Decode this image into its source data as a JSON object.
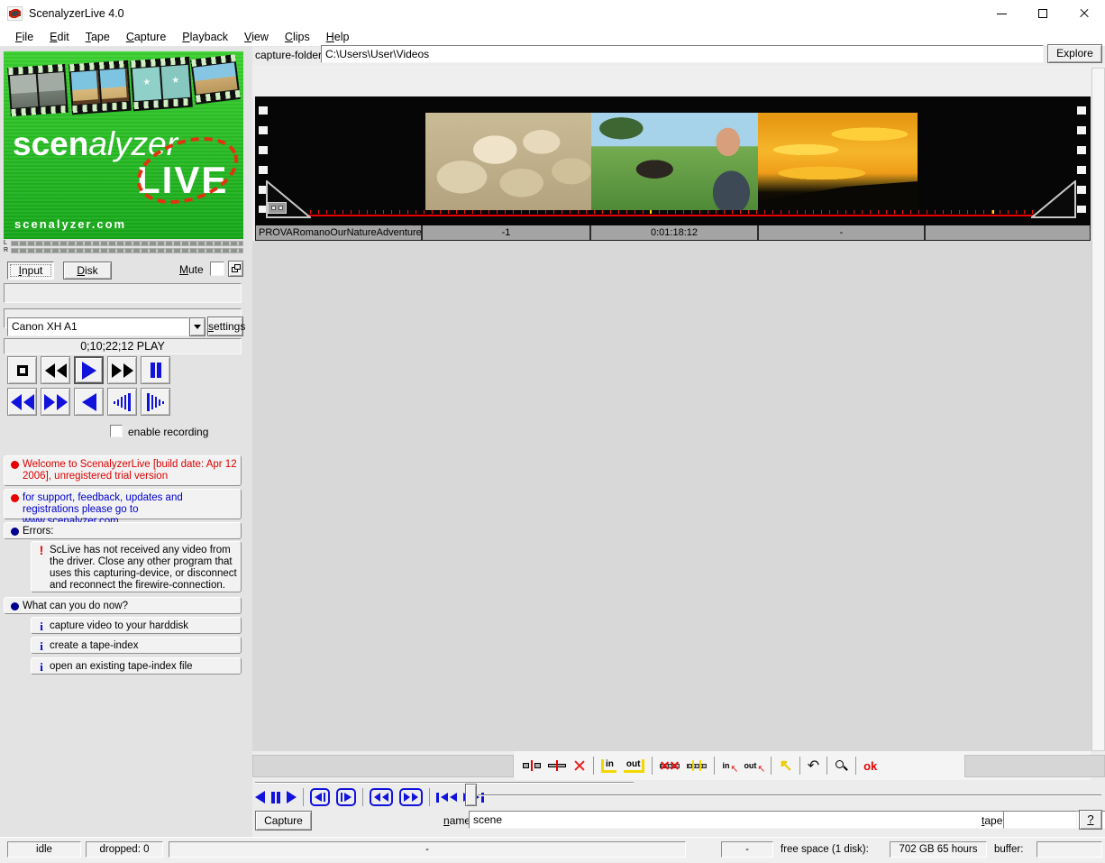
{
  "window": {
    "title": "ScenalyzerLive 4.0"
  },
  "menu": {
    "items": [
      "File",
      "Edit",
      "Tape",
      "Capture",
      "Playback",
      "View",
      "Clips",
      "Help"
    ]
  },
  "capture_folder": {
    "label": "capture-folder:",
    "path": "C:\\Users\\User\\Videos",
    "explore_button": "Explore"
  },
  "logo": {
    "brand_bold": "scen",
    "brand_italic": "alyzer",
    "live": "LIVE",
    "site": "scenalyzer.com"
  },
  "sidebar": {
    "meter_left": "L",
    "meter_right": "R",
    "input_button": "Input",
    "disk_button": "Disk",
    "mute_label": "Mute",
    "device_selected": "Canon XH A1",
    "settings_button": "settings",
    "timecode": "0;10;22;12 PLAY",
    "enable_recording_label": "enable recording",
    "messages": [
      {
        "text": "Welcome to ScenalyzerLive [build date: Apr 12 2006], unregistered trial version"
      },
      {
        "text": "for support, feedback, updates and registrations please go to www.scenalyzer.com"
      },
      {
        "text": "Errors:"
      },
      {
        "text": "ScLive has not received any video from the driver. Close any other program that uses this capturing-device, or disconnect and reconnect the firewire-connection."
      },
      {
        "text": "What can you do now?"
      },
      {
        "text": "capture video to your harddisk"
      },
      {
        "text": "create a tape-index"
      },
      {
        "text": "open an existing tape-index file"
      }
    ]
  },
  "filmstrip": {
    "labels": [
      "PROVARomanoOurNatureAdventure",
      "-1",
      "0:01:18:12",
      "-",
      ""
    ],
    "thumbnails": [
      "sheep-flock",
      "boy-with-horse",
      "sunset"
    ]
  },
  "toolbar": {
    "in_label": "in",
    "out_label": "out",
    "goto_in_label": "in",
    "goto_out_label": "out",
    "ok_label": "ok"
  },
  "capture_row": {
    "capture_button": "Capture",
    "name_label": "name:",
    "name_value": "scene",
    "tape_label": "tape:",
    "tape_value": "",
    "help_button": "?"
  },
  "status_bar": {
    "state": "idle",
    "dropped": "dropped: 0",
    "center_value": "-",
    "dash_value": "-",
    "free_space_label": "free space (1 disk):",
    "free_space_value": "702 GB 65 hours",
    "buffer_label": "buffer:",
    "buffer_value": ""
  },
  "colors": {
    "accent_blue": "#1212dd",
    "alert_red": "#e80000",
    "link_blue": "#0000cc",
    "logo_green": "#2bbf24",
    "filmstrip_black": "#060606",
    "label_row_grey": "#a4a4a4"
  }
}
